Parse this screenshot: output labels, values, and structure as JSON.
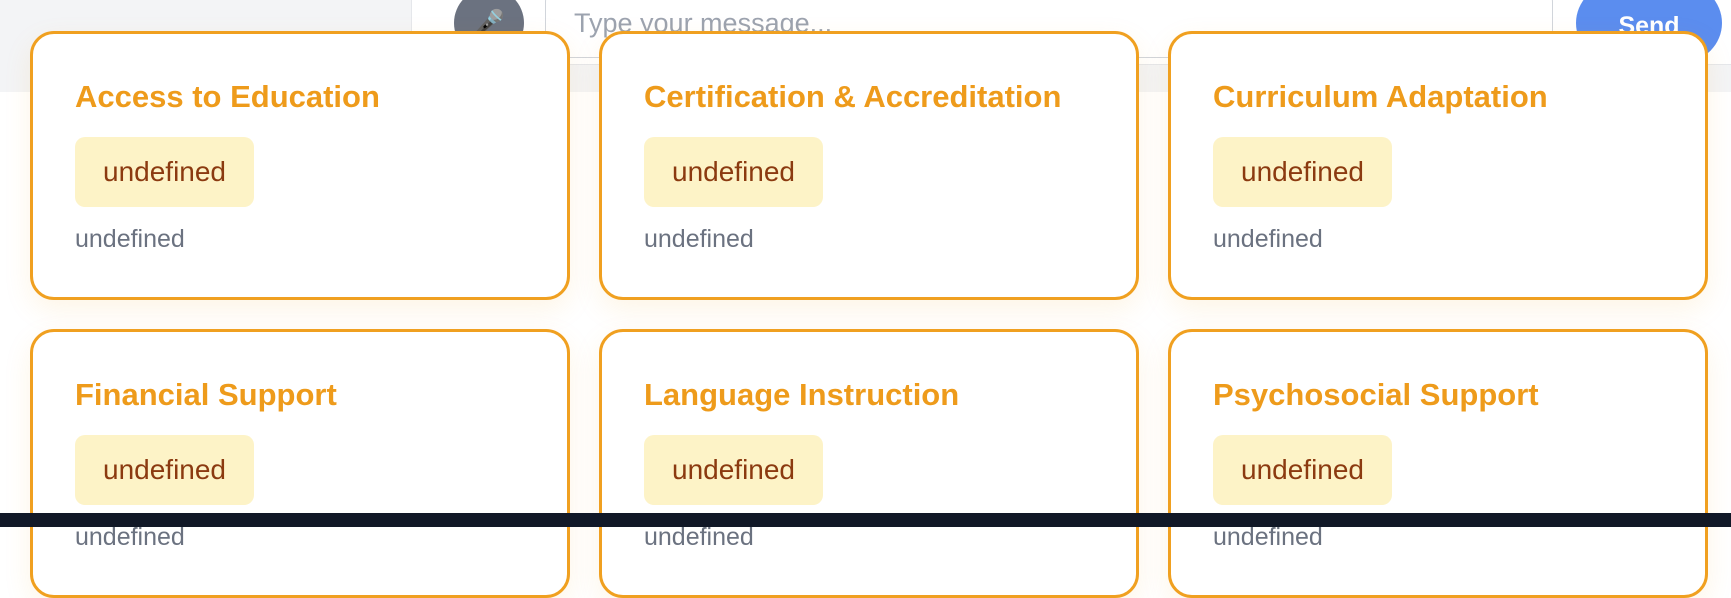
{
  "chat": {
    "mic_icon": "microphone-icon",
    "mic_glyph": "🎤",
    "input_placeholder": "Type your message...",
    "input_value": "",
    "send_label": "Send"
  },
  "cards": [
    {
      "title": "Access to Education",
      "badge": "undefined",
      "description": "undefined"
    },
    {
      "title": "Certification & Accreditation",
      "badge": "undefined",
      "description": "undefined"
    },
    {
      "title": "Curriculum Adaptation",
      "badge": "undefined",
      "description": "undefined"
    },
    {
      "title": "Financial Support",
      "badge": "undefined",
      "description": "undefined"
    },
    {
      "title": "Language Instruction",
      "badge": "undefined",
      "description": "undefined"
    },
    {
      "title": "Psychosocial Support",
      "badge": "undefined",
      "description": "undefined"
    }
  ],
  "colors": {
    "card_border": "#f0a020",
    "card_title": "#ee9b1b",
    "badge_bg": "#fdf3c7",
    "badge_text": "#8b3a10",
    "send_button": "#5b8def",
    "bottom_bar": "#111827"
  }
}
